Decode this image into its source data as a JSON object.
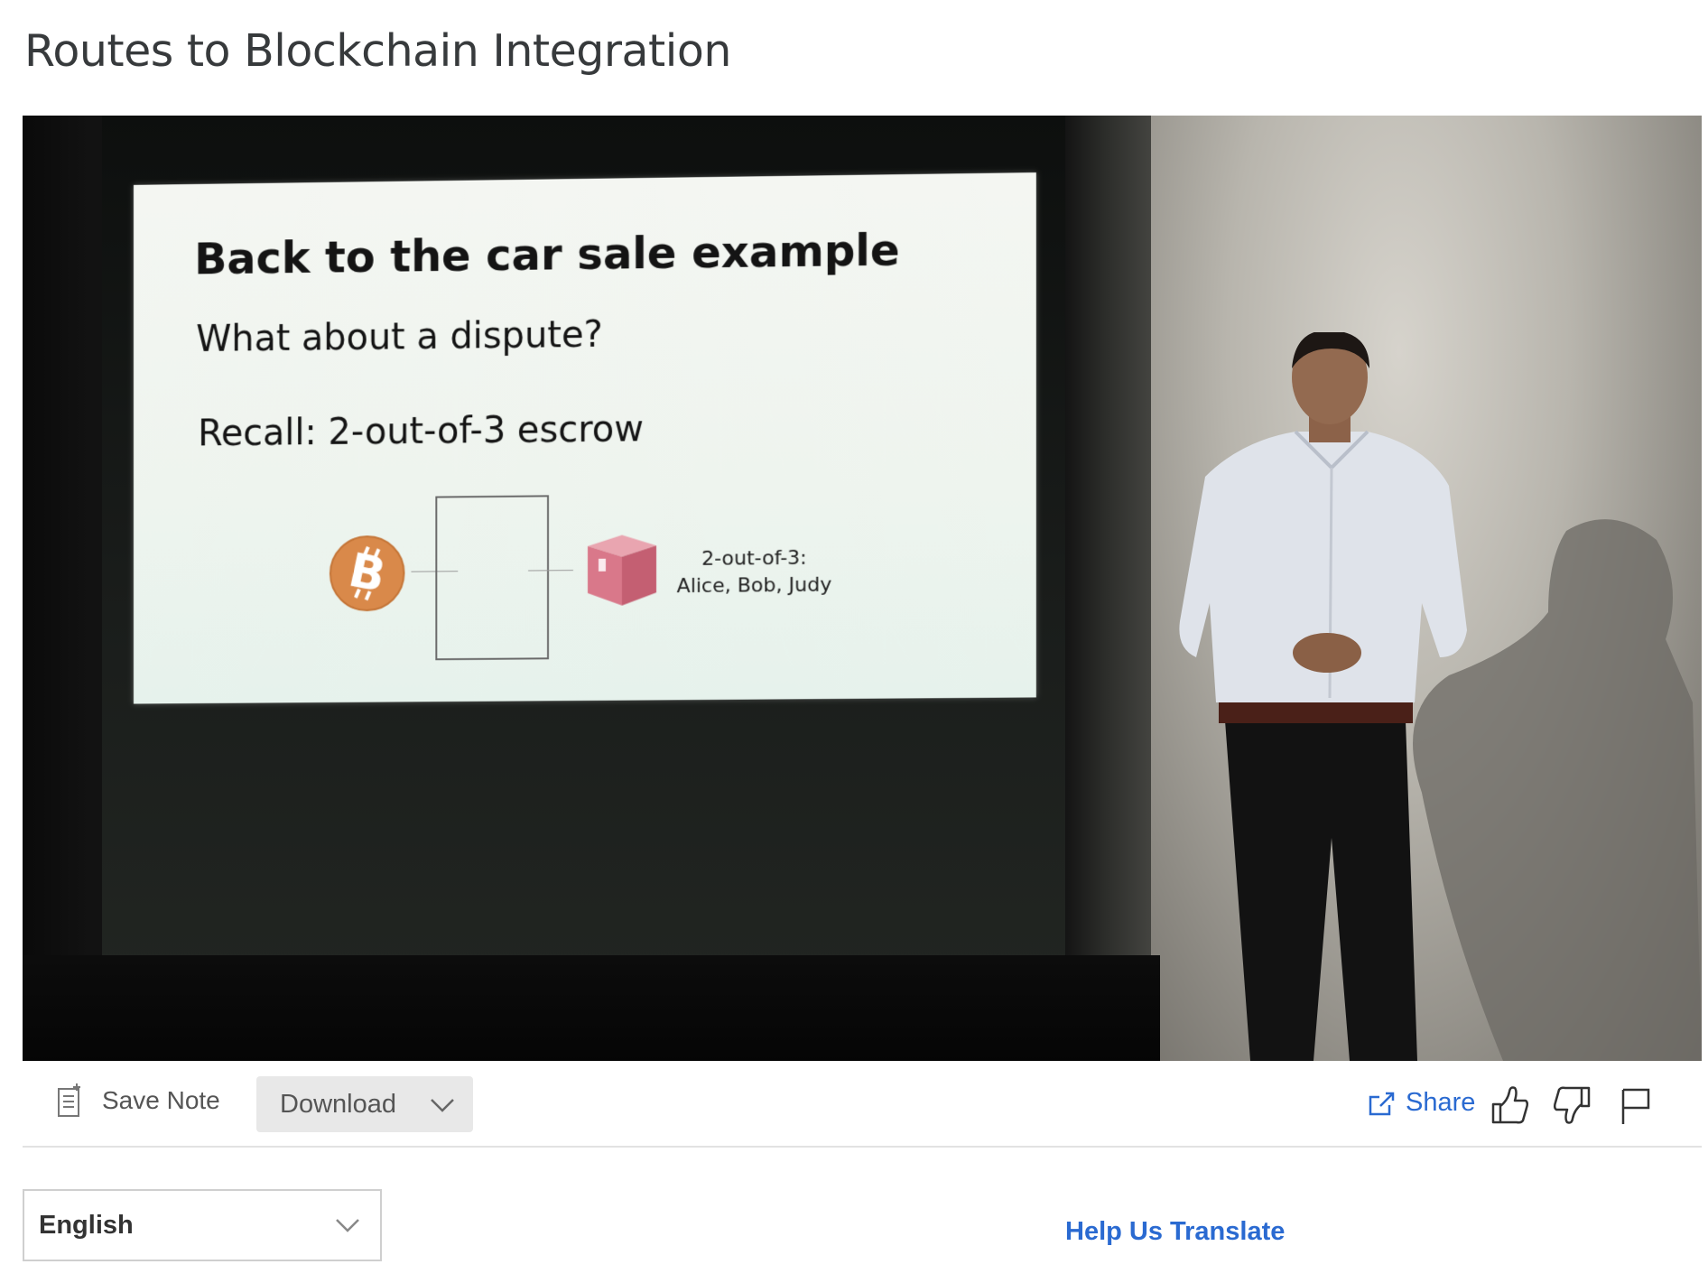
{
  "page": {
    "title": "Routes to Blockchain Integration"
  },
  "video": {
    "slide": {
      "title": "Back to the car sale example",
      "question": "What about a dispute?",
      "recall": "Recall: 2-out-of-3 escrow",
      "escrow_label_line1": "2-out-of-3:",
      "escrow_label_line2": "Alice, Bob, Judy"
    },
    "icons": [
      "bitcoin-icon",
      "lockbox-icon"
    ]
  },
  "toolbar": {
    "save_note_label": "Save Note",
    "download_label": "Download",
    "share_label": "Share",
    "icons": [
      "note-icon",
      "chevron-down-icon",
      "share-icon",
      "thumbs-up-icon",
      "thumbs-down-icon",
      "flag-icon"
    ],
    "link_color": "#2a6ad1"
  },
  "transcript": {
    "language_selected": "English",
    "help_translate_label": "Help Us Translate"
  }
}
